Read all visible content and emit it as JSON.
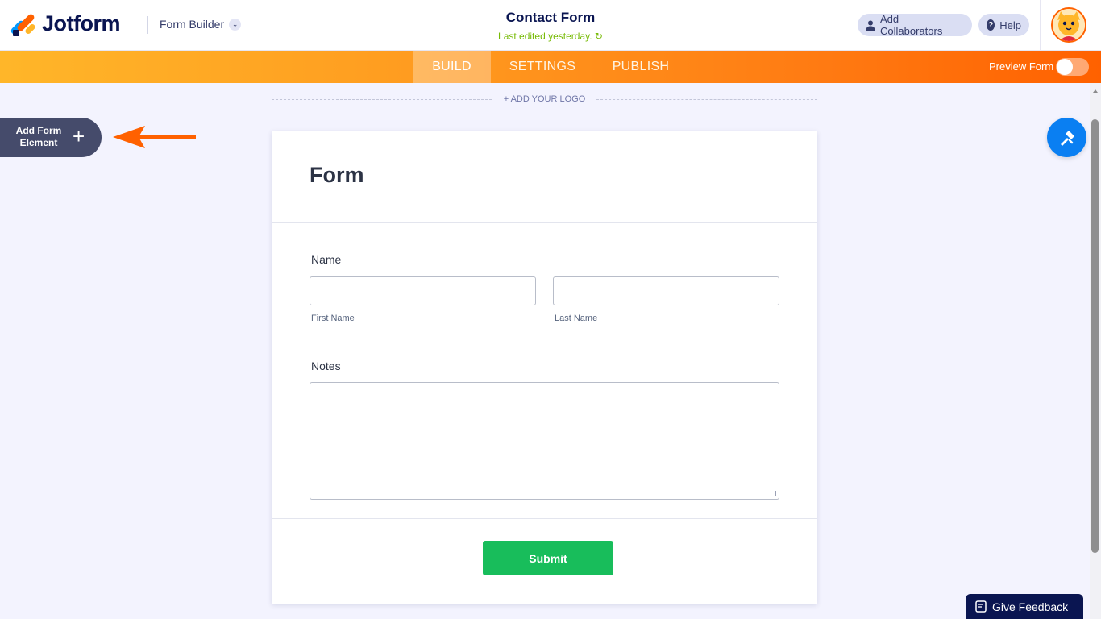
{
  "header": {
    "logo_text": "Jotform",
    "builder_label": "Form Builder",
    "form_title": "Contact Form",
    "last_edited": "Last edited yesterday.",
    "add_collaborators": "Add Collaborators",
    "help": "Help"
  },
  "nav": {
    "tabs": [
      {
        "label": "BUILD",
        "active": true
      },
      {
        "label": "SETTINGS",
        "active": false
      },
      {
        "label": "PUBLISH",
        "active": false
      }
    ],
    "preview_label": "Preview Form",
    "preview_on": false
  },
  "canvas": {
    "add_logo": "+ ADD YOUR LOGO",
    "add_element": "Add Form Element"
  },
  "form": {
    "heading": "Form",
    "name_label": "Name",
    "first_name_sublabel": "First Name",
    "last_name_sublabel": "Last Name",
    "first_name_value": "",
    "last_name_value": "",
    "notes_label": "Notes",
    "notes_value": "",
    "submit_label": "Submit"
  },
  "feedback_label": "Give Feedback",
  "colors": {
    "brand_orange": "#ff6100",
    "brand_navy": "#0a1551",
    "submit_green": "#18bd5b",
    "paint_blue": "#0a7ff2",
    "edited_green": "#78bb07"
  }
}
